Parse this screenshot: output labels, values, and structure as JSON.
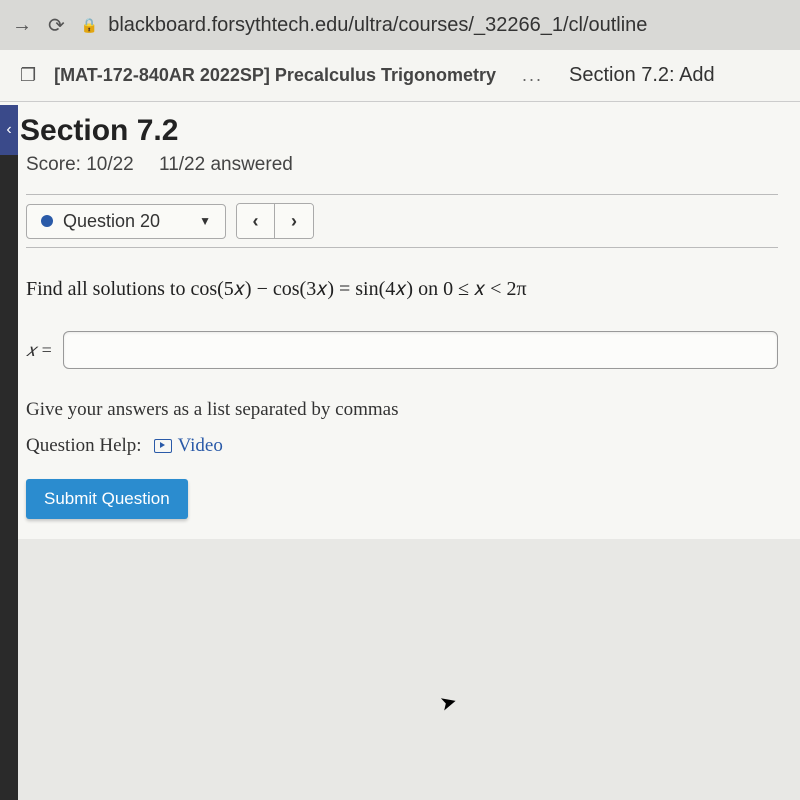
{
  "browser": {
    "url": "blackboard.forsythtech.edu/ultra/courses/_32266_1/cl/outline"
  },
  "course": {
    "name": "[MAT-172-840AR 2022SP] Precalculus Trigonometry",
    "section_nav": "Section 7.2: Add"
  },
  "page": {
    "title": "Section 7.2",
    "score_label": "Score: 10/22",
    "answered_label": "11/22 answered"
  },
  "question": {
    "dropdown_label": "Question 20",
    "problem_prefix": "Find all solutions to ",
    "problem_math": "cos(5𝑥) − cos(3𝑥) = sin(4𝑥) on 0 ≤ 𝑥 < 2π",
    "input_label": "𝑥 =",
    "input_value": "",
    "hint": "Give your answers as a list separated by commas",
    "help_label": "Question Help:",
    "video_label": "Video",
    "submit_label": "Submit Question"
  }
}
